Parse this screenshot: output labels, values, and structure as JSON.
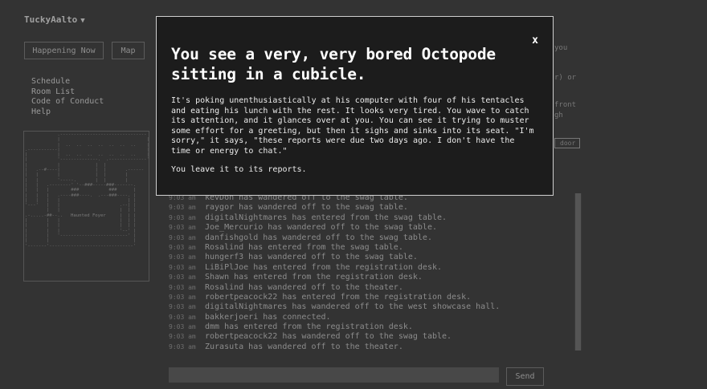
{
  "header": {
    "username": "TuckyAalto",
    "happening_now_label": "Happening Now",
    "map_label": "Map"
  },
  "nav": {
    "items": [
      "Schedule",
      "Room List",
      "Code of Conduct",
      "Help"
    ]
  },
  "map": {
    "labels": [
      "Haunted Foyer"
    ]
  },
  "background_fragments": [
    "you",
    "r) or",
    "front",
    "gh",
    "door"
  ],
  "chat": {
    "lines": [
      {
        "time": "9:03 am",
        "text": "kevDon has wandered off to the swag table."
      },
      {
        "time": "9:03 am",
        "text": "raygor has wandered off to the swag table."
      },
      {
        "time": "9:03 am",
        "text": "digitalNightmares has entered from the swag table."
      },
      {
        "time": "9:03 am",
        "text": "Joe_Mercurio has wandered off to the swag table."
      },
      {
        "time": "9:03 am",
        "text": "danfishgold has wandered off to the swag table."
      },
      {
        "time": "9:03 am",
        "text": "Rosalind has entered from the swag table."
      },
      {
        "time": "9:03 am",
        "text": "hungerf3 has wandered off to the swag table."
      },
      {
        "time": "9:03 am",
        "text": "LiBiPlJoe has entered from the registration desk."
      },
      {
        "time": "9:03 am",
        "text": "Shawn has entered from the registration desk."
      },
      {
        "time": "9:03 am",
        "text": "Rosalind has wandered off to the theater."
      },
      {
        "time": "9:03 am",
        "text": "robertpeacock22 has entered from the registration desk."
      },
      {
        "time": "9:03 am",
        "text": "digitalNightmares has wandered off to the west showcase hall."
      },
      {
        "time": "9:03 am",
        "text": "bakkerjoeri has connected."
      },
      {
        "time": "9:03 am",
        "text": "dmm has entered from the registration desk."
      },
      {
        "time": "9:03 am",
        "text": "robertpeacock22 has wandered off to the swag table."
      },
      {
        "time": "9:03 am",
        "text": "Zurasuta has wandered off to the theater."
      }
    ],
    "input_value": "",
    "send_label": "Send"
  },
  "modal": {
    "title": "You see a very, very bored Octopode sitting in a cubicle.",
    "paragraphs": [
      "It's poking unenthusiastically at his computer with four of his tentacles and eating his lunch with the rest. It looks very tired. You wave to catch its attention, and it glances over at you. You can see it trying to muster some effort for a greeting, but then it sighs and sinks into its seat. \"I'm sorry,\" it says, \"these reports were due two days ago. I don't have the time or energy to chat.\"",
      "You leave it to its reports."
    ],
    "close_label": "x"
  },
  "colors": {
    "background": "#333333",
    "modal_background": "#1c1c1c",
    "modal_border": "#cfcfcf"
  }
}
